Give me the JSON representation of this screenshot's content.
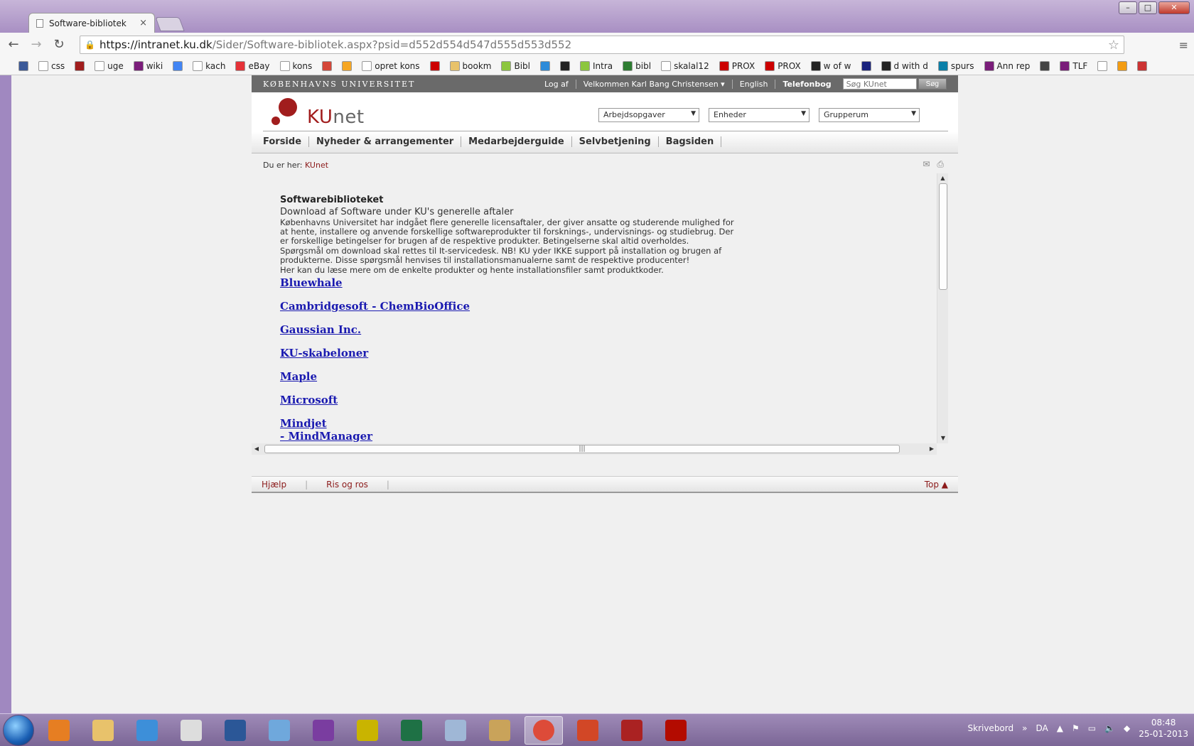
{
  "window": {
    "tab_title": "Software-bibliotek",
    "tab_close": "×",
    "controls": {
      "minimize": "–",
      "maximize": "□",
      "close": "✕"
    }
  },
  "toolbar": {
    "back": "←",
    "forward": "→",
    "reload": "↻",
    "url_scheme_host": "https://intranet.ku.dk",
    "url_rest": "/Sider/Software-bibliotek.aspx?psid=d552d554d547d555d553d552",
    "star": "☆",
    "menu": "≡"
  },
  "bookmarks": [
    {
      "label": "",
      "color": "#3b5998"
    },
    {
      "label": "css",
      "color": "#ffffff"
    },
    {
      "label": "",
      "color": "#a11d1d"
    },
    {
      "label": "uge",
      "color": "#ffffff"
    },
    {
      "label": "wiki",
      "color": "#7a1d7a"
    },
    {
      "label": "",
      "color": "#4285f4"
    },
    {
      "label": "kach",
      "color": "#ffffff"
    },
    {
      "label": "eBay",
      "color": "#e53238"
    },
    {
      "label": "kons",
      "color": "#ffffff"
    },
    {
      "label": "",
      "color": "#d44638"
    },
    {
      "label": "",
      "color": "#f5a623"
    },
    {
      "label": "opret kons",
      "color": "#ffffff"
    },
    {
      "label": "",
      "color": "#cc0000"
    },
    {
      "label": "bookm",
      "color": "#e8c26b"
    },
    {
      "label": "Bibl",
      "color": "#8cc63f"
    },
    {
      "label": "",
      "color": "#2e8bd9"
    },
    {
      "label": "",
      "color": "#222222"
    },
    {
      "label": "Intra",
      "color": "#8cc63f"
    },
    {
      "label": "bibl",
      "color": "#2e7d32"
    },
    {
      "label": "skalal12",
      "color": "#ffffff"
    },
    {
      "label": "PROX",
      "color": "#cc0000"
    },
    {
      "label": "PROX",
      "color": "#cc0000"
    },
    {
      "label": "w of w",
      "color": "#222222"
    },
    {
      "label": "",
      "color": "#1a237e"
    },
    {
      "label": "d with d",
      "color": "#222222"
    },
    {
      "label": "spurs",
      "color": "#0a7fa8"
    },
    {
      "label": "Ann rep",
      "color": "#7a1d7a"
    },
    {
      "label": "",
      "color": "#444444"
    },
    {
      "label": "TLF",
      "color": "#7a1d7a"
    },
    {
      "label": "",
      "color": "#ffffff"
    },
    {
      "label": "",
      "color": "#f39c12"
    },
    {
      "label": "",
      "color": "#cc3333"
    }
  ],
  "ku": {
    "brand": "KØBENHAVNS UNIVERSITET",
    "toplinks": {
      "logout": "Log af",
      "welcome": "Velkommen Karl Bang Christensen ▾",
      "english": "English",
      "phonebook": "Telefonbog"
    },
    "search": {
      "placeholder": "Søg KUnet",
      "button": "Søg"
    },
    "logo": {
      "ku": "KU",
      "net": "net"
    },
    "selects": [
      "Arbejdsopgaver",
      "Enheder",
      "Grupperum"
    ],
    "nav": [
      "Forside",
      "Nyheder & arrangementer",
      "Medarbejderguide",
      "Selvbetjening",
      "Bagsiden"
    ],
    "breadcrumb": {
      "label": "Du er her:",
      "link": "KUnet"
    },
    "icons": {
      "email": "✉",
      "print": "⎙"
    }
  },
  "content": {
    "title": "Softwarebiblioteket",
    "subtitle": "Download af Software under KU's generelle aftaler",
    "paragraphs": [
      "Københavns Universitet har indgået flere generelle licensaftaler, der giver ansatte og studerende mulighed for at hente, installere og anvende forskellige softwareprodukter til forsknings-, undervisnings- og studiebrug. Der er forskellige betingelser for brugen af de respektive produkter. Betingelserne skal altid overholdes.",
      "Spørgsmål om download skal rettes til It-servicedesk. NB! KU yder IKKE support på installation og brugen af produkterne. Disse spørgsmål henvises til installationsmanualerne samt de respektive producenter!",
      "Her kan du læse mere om de enkelte produkter og hente installationsfiler samt produktkoder."
    ],
    "products": [
      "Bluewhale",
      "Cambridgesoft - ChemBioOffice",
      "Gaussian Inc.",
      "KU-skabeloner",
      "Maple",
      "Microsoft",
      "Mindjet"
    ],
    "product_sub": "- MindManager"
  },
  "footer": {
    "help": "Hjælp",
    "feedback": "Ris og ros",
    "top": "Top ▲"
  },
  "taskbar": {
    "apps": [
      {
        "name": "media-player",
        "color": "#e67e22"
      },
      {
        "name": "explorer",
        "color": "#e8c26b"
      },
      {
        "name": "dropbox",
        "color": "#3d8fd9"
      },
      {
        "name": "notepad",
        "color": "#dddddd"
      },
      {
        "name": "word",
        "color": "#2b5797"
      },
      {
        "name": "notebook",
        "color": "#6fa8dc"
      },
      {
        "name": "headphones",
        "color": "#7a3da0"
      },
      {
        "name": "tools",
        "color": "#c9b400"
      },
      {
        "name": "excel",
        "color": "#1e7145"
      },
      {
        "name": "calculator",
        "color": "#9fb7d6"
      },
      {
        "name": "paint",
        "color": "#c9a35a"
      },
      {
        "name": "chrome",
        "color": "#dd4b39"
      },
      {
        "name": "powerpoint",
        "color": "#d24726"
      },
      {
        "name": "network-tool",
        "color": "#aa2222"
      },
      {
        "name": "acrobat",
        "color": "#b30b00"
      }
    ],
    "desktop_label": "Skrivebord",
    "expand": "»",
    "lang": "DA",
    "time": "08:48",
    "date": "25-01-2013"
  }
}
